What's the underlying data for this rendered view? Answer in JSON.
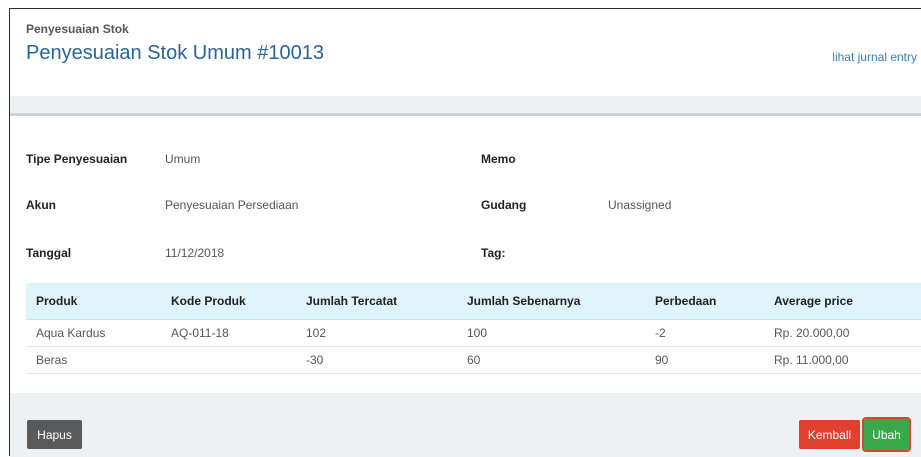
{
  "header": {
    "kicker": "Penyesuaian Stok",
    "title": "Penyesuaian Stok Umum #10013",
    "journal_link": "lihat jurnal entry"
  },
  "details": {
    "tipe_label": "Tipe Penyesuaian",
    "tipe_value": "Umum",
    "memo_label": "Memo",
    "memo_value": "",
    "akun_label": "Akun",
    "akun_value": "Penyesuaian Persediaan",
    "gudang_label": "Gudang",
    "gudang_value": "Unassigned",
    "tanggal_label": "Tanggal",
    "tanggal_value": "11/12/2018",
    "tag_label": "Tag:",
    "tag_value": ""
  },
  "table": {
    "headers": [
      "Produk",
      "Kode Produk",
      "Jumlah Tercatat",
      "Jumlah Sebenarnya",
      "Perbedaan",
      "Average price"
    ],
    "rows": [
      [
        "Aqua Kardus",
        "AQ-011-18",
        "102",
        "100",
        "-2",
        "Rp. 20.000,00"
      ],
      [
        "Beras",
        "",
        "-30",
        "60",
        "90",
        "Rp. 11.000,00"
      ]
    ]
  },
  "actions": {
    "delete_label": "Hapus",
    "back_label": "Kembali",
    "edit_label": "Ubah"
  },
  "colors": {
    "title": "#2a6496",
    "link": "#3a7ebf",
    "table_header_bg": "#dff3fb",
    "delete_btn": "#5a5a5a",
    "back_btn": "#e0402e",
    "edit_btn": "#39a84a"
  }
}
